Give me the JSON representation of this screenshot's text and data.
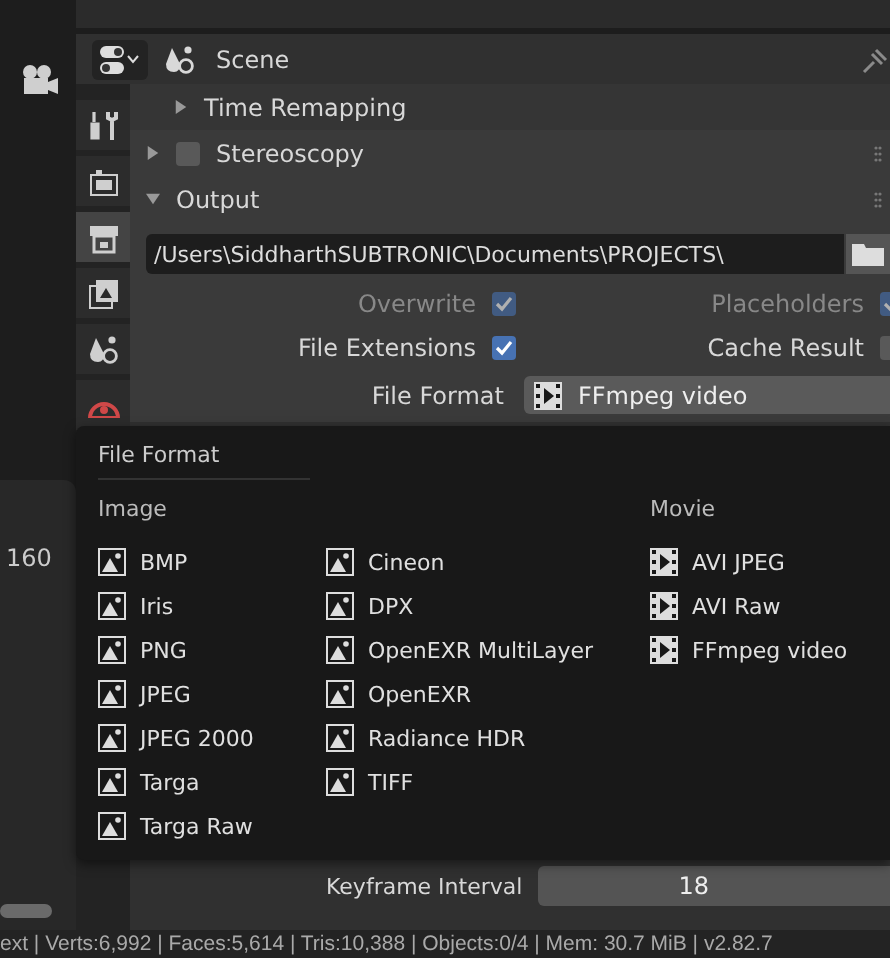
{
  "left_editor": {
    "frame_number": "160"
  },
  "properties": {
    "header": {
      "context": "Scene"
    },
    "tabs": [
      {
        "kind": "tool",
        "selected": false
      },
      {
        "kind": "render",
        "selected": false
      },
      {
        "kind": "output",
        "selected": true
      },
      {
        "kind": "view_layer",
        "selected": false
      },
      {
        "kind": "scene",
        "selected": false
      },
      {
        "kind": "world",
        "selected": false
      }
    ],
    "panels": [
      {
        "title": "Time Remapping",
        "kind": "subpanel",
        "expanded": false
      },
      {
        "title": "Stereoscopy",
        "kind": "checkbox",
        "expanded": false,
        "checked": false
      },
      {
        "title": "Output",
        "kind": "panel",
        "expanded": true
      }
    ],
    "output": {
      "path": "/Users\\SiddharthSUBTRONIC\\Documents\\PROJECTS\\",
      "options": [
        {
          "label": "Overwrite",
          "checked": true,
          "disabled": true
        },
        {
          "label": "Placeholders",
          "checked": true,
          "disabled": true
        },
        {
          "label": "File Extensions",
          "checked": true,
          "disabled": false
        },
        {
          "label": "Cache Result",
          "checked": false,
          "disabled": false
        }
      ],
      "file_format": {
        "label": "File Format",
        "value": "FFmpeg video"
      }
    },
    "keyframe_interval": {
      "label": "Keyframe Interval",
      "value": "18"
    }
  },
  "menu": {
    "title": "File Format",
    "columns": [
      {
        "heading": "Image",
        "kind": "image",
        "items": [
          "BMP",
          "Iris",
          "PNG",
          "JPEG",
          "JPEG 2000",
          "Targa",
          "Targa Raw"
        ]
      },
      {
        "kind": "image",
        "items": [
          "Cineon",
          "DPX",
          "OpenEXR MultiLayer",
          "OpenEXR",
          "Radiance HDR",
          "TIFF"
        ]
      },
      {
        "heading": "Movie",
        "kind": "movie",
        "items": [
          "AVI JPEG",
          "AVI Raw",
          "FFmpeg video"
        ]
      }
    ]
  },
  "status_bar": {
    "text": "ext | Verts:6,992 | Faces:5,614 | Tris:10,388 | Objects:0/4 | Mem: 30.7 MiB | v2.82.7"
  }
}
